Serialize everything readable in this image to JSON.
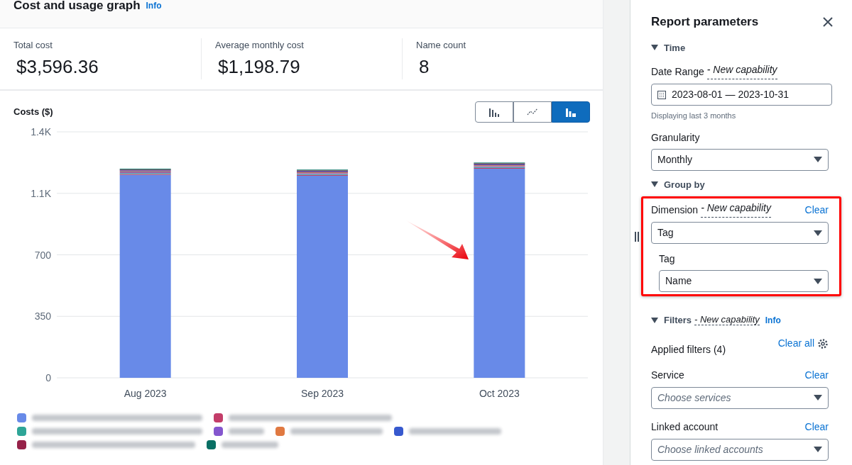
{
  "header": {
    "title": "Cost and usage graph",
    "info_link": "Info"
  },
  "stats": [
    {
      "label": "Total cost",
      "value": "$3,596.36"
    },
    {
      "label": "Average monthly cost",
      "value": "$1,198.79"
    },
    {
      "label": "Name count",
      "value": "8"
    }
  ],
  "view_buttons": [
    {
      "kind": "bar",
      "selected": false
    },
    {
      "kind": "line",
      "selected": false
    },
    {
      "kind": "stacked",
      "selected": true
    }
  ],
  "chart_data": {
    "type": "bar",
    "stacked": true,
    "title": "Costs ($)",
    "categories": [
      "Aug 2023",
      "Sep 2023",
      "Oct 2023"
    ],
    "ylim": [
      0,
      1400
    ],
    "yticks": [
      0,
      350,
      700,
      {
        "value": 1050,
        "label": "1.1K"
      },
      {
        "value": 1400,
        "label": "1.4K"
      }
    ],
    "series": [
      {
        "color": "#688ae8",
        "values": [
          1155,
          1150,
          1190
        ]
      },
      {
        "color": "#c33d69",
        "values": [
          5,
          5,
          5
        ]
      },
      {
        "color": "#2ea597",
        "values": [
          5,
          5,
          5
        ]
      },
      {
        "color": "#8456ce",
        "values": [
          5,
          5,
          5
        ]
      },
      {
        "color": "#e07941",
        "values": [
          5,
          5,
          5
        ]
      },
      {
        "color": "#3759ce",
        "values": [
          5,
          5,
          5
        ]
      },
      {
        "color": "#962249",
        "values": [
          5,
          5,
          5
        ]
      },
      {
        "color": "#096f64",
        "values": [
          5,
          5,
          5
        ]
      }
    ],
    "grid": true
  },
  "panel": {
    "title": "Report parameters",
    "time": {
      "heading": "Time",
      "expanded": true,
      "date_label": "Date Range",
      "date_tag": "- New capability",
      "date_value": "2023-08-01 — 2023-10-31",
      "hint": "Displaying last 3 months",
      "granularity_label": "Granularity",
      "granularity_value": "Monthly"
    },
    "group_by": {
      "heading": "Group by",
      "expanded": true,
      "dimension_label": "Dimension",
      "dimension_tag": "- New capability",
      "clear": "Clear",
      "dimension_value": "Tag",
      "tag_label": "Tag",
      "tag_value": "Name"
    },
    "filters": {
      "heading": "Filters",
      "expanded": true,
      "tag": "- New capability",
      "info": "Info",
      "applied": "Applied filters (4)",
      "clear_all": "Clear all",
      "fields": [
        {
          "label": "Service",
          "clear": "Clear",
          "placeholder": "Choose services"
        },
        {
          "label": "Linked account",
          "clear": "Clear",
          "placeholder": "Choose linked accounts"
        }
      ]
    }
  }
}
